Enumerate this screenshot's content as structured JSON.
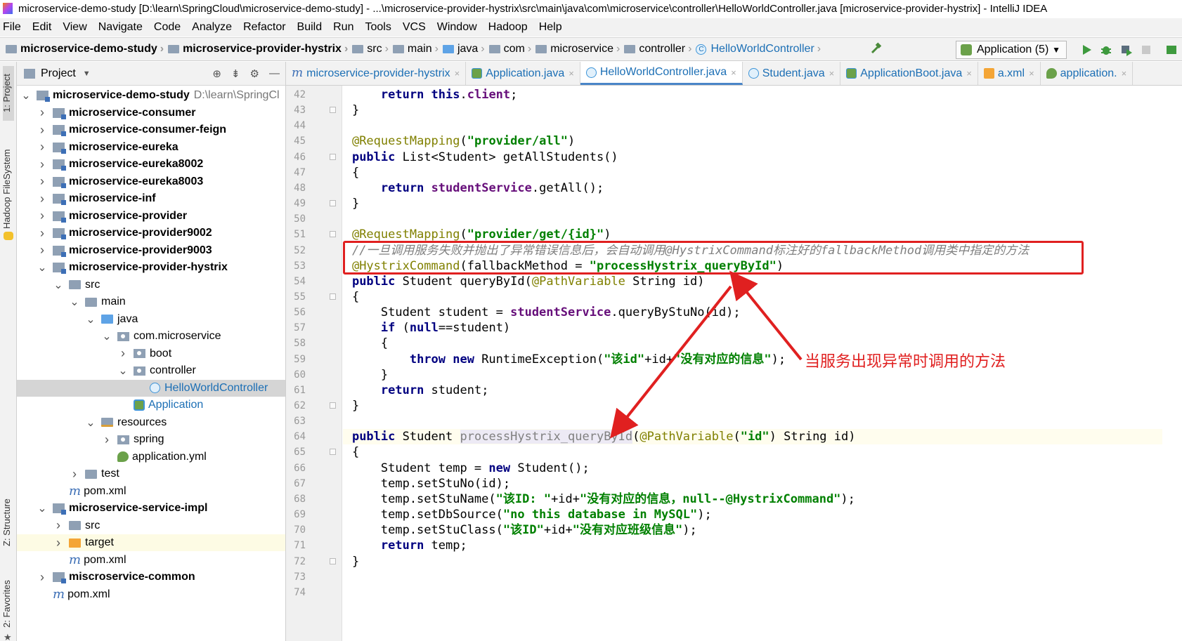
{
  "window": {
    "title": "microservice-demo-study [D:\\learn\\SpringCloud\\microservice-demo-study] - ...\\microservice-provider-hystrix\\src\\main\\java\\com\\microservice\\controller\\HelloWorldController.java [microservice-provider-hystrix] - IntelliJ IDEA"
  },
  "menu": [
    "File",
    "Edit",
    "View",
    "Navigate",
    "Code",
    "Analyze",
    "Refactor",
    "Build",
    "Run",
    "Tools",
    "VCS",
    "Window",
    "Hadoop",
    "Help"
  ],
  "breadcrumbs": [
    "microservice-demo-study",
    "microservice-provider-hystrix",
    "src",
    "main",
    "java",
    "com",
    "microservice",
    "controller",
    "HelloWorldController"
  ],
  "run_config": {
    "label": "Application (5)"
  },
  "left_strip": {
    "project": "1: Project",
    "hadoop": "Hadoop FileSystem",
    "structure": "Z: Structure",
    "favorites": "2: Favorites"
  },
  "project_panel": {
    "title": "Project",
    "tree": [
      {
        "label": "microservice-demo-study",
        "path": "D:\\learn\\SpringCl",
        "indent": 0,
        "arrow": "down",
        "icon": "mod",
        "bold": true
      },
      {
        "label": "microservice-consumer",
        "indent": 1,
        "arrow": "right",
        "icon": "mod",
        "bold": true
      },
      {
        "label": "microservice-consumer-feign",
        "indent": 1,
        "arrow": "right",
        "icon": "mod",
        "bold": true
      },
      {
        "label": "microservice-eureka",
        "indent": 1,
        "arrow": "right",
        "icon": "mod",
        "bold": true
      },
      {
        "label": "microservice-eureka8002",
        "indent": 1,
        "arrow": "right",
        "icon": "mod",
        "bold": true
      },
      {
        "label": "microservice-eureka8003",
        "indent": 1,
        "arrow": "right",
        "icon": "mod",
        "bold": true
      },
      {
        "label": "microservice-inf",
        "indent": 1,
        "arrow": "right",
        "icon": "mod",
        "bold": true
      },
      {
        "label": "microservice-provider",
        "indent": 1,
        "arrow": "right",
        "icon": "mod",
        "bold": true
      },
      {
        "label": "microservice-provider9002",
        "indent": 1,
        "arrow": "right",
        "icon": "mod",
        "bold": true
      },
      {
        "label": "microservice-provider9003",
        "indent": 1,
        "arrow": "right",
        "icon": "mod",
        "bold": true
      },
      {
        "label": "microservice-provider-hystrix",
        "indent": 1,
        "arrow": "down",
        "icon": "mod",
        "bold": true
      },
      {
        "label": "src",
        "indent": 2,
        "arrow": "down",
        "icon": "folder"
      },
      {
        "label": "main",
        "indent": 3,
        "arrow": "down",
        "icon": "folder"
      },
      {
        "label": "java",
        "indent": 4,
        "arrow": "down",
        "icon": "src"
      },
      {
        "label": "com.microservice",
        "indent": 5,
        "arrow": "down",
        "icon": "pkg"
      },
      {
        "label": "boot",
        "indent": 6,
        "arrow": "right",
        "icon": "pkg"
      },
      {
        "label": "controller",
        "indent": 6,
        "arrow": "down",
        "icon": "pkg"
      },
      {
        "label": "HelloWorldController",
        "indent": 7,
        "arrow": "",
        "icon": "class",
        "selected": true,
        "blue": true
      },
      {
        "label": "Application",
        "indent": 6,
        "arrow": "",
        "icon": "app",
        "blue": true
      },
      {
        "label": "resources",
        "indent": 4,
        "arrow": "down",
        "icon": "res"
      },
      {
        "label": "spring",
        "indent": 5,
        "arrow": "right",
        "icon": "pkg"
      },
      {
        "label": "application.yml",
        "indent": 5,
        "arrow": "",
        "icon": "yml"
      },
      {
        "label": "test",
        "indent": 3,
        "arrow": "right",
        "icon": "folder"
      },
      {
        "label": "pom.xml",
        "indent": 2,
        "arrow": "",
        "icon": "m"
      },
      {
        "label": "microservice-service-impl",
        "indent": 1,
        "arrow": "down",
        "icon": "mod",
        "bold": true
      },
      {
        "label": "src",
        "indent": 2,
        "arrow": "right",
        "icon": "folder"
      },
      {
        "label": "target",
        "indent": 2,
        "arrow": "right",
        "icon": "orange",
        "highlight": true
      },
      {
        "label": "pom.xml",
        "indent": 2,
        "arrow": "",
        "icon": "m"
      },
      {
        "label": "miscroservice-common",
        "indent": 1,
        "arrow": "right",
        "icon": "mod",
        "bold": true
      },
      {
        "label": "pom.xml",
        "indent": 1,
        "arrow": "",
        "icon": "m"
      }
    ]
  },
  "tabs": [
    {
      "label": "microservice-provider-hystrix",
      "icon": "m"
    },
    {
      "label": "Application.java",
      "icon": "app"
    },
    {
      "label": "HelloWorldController.java",
      "icon": "class",
      "active": true
    },
    {
      "label": "Student.java",
      "icon": "class"
    },
    {
      "label": "ApplicationBoot.java",
      "icon": "app"
    },
    {
      "label": "a.xml",
      "icon": "xml"
    },
    {
      "label": "application.",
      "icon": "yml"
    }
  ],
  "code": {
    "current_line": 64,
    "lines": [
      {
        "n": 42,
        "html": "        <span class='kw'>return this</span>.<span class='fld'>client</span>;"
      },
      {
        "n": 43,
        "html": "    }"
      },
      {
        "n": 44,
        "html": ""
      },
      {
        "n": 45,
        "html": "    <span class='an'>@RequestMapping</span>(<span class='str'>\"provider/all\"</span>)"
      },
      {
        "n": 46,
        "html": "    <span class='kw'>public</span> List&lt;Student&gt; getAllStudents()"
      },
      {
        "n": 47,
        "html": "    {"
      },
      {
        "n": 48,
        "html": "        <span class='kw'>return</span> <span class='fld'>studentService</span>.getAll();"
      },
      {
        "n": 49,
        "html": "    }"
      },
      {
        "n": 50,
        "html": ""
      },
      {
        "n": 51,
        "html": "    <span class='an'>@RequestMapping</span>(<span class='str'>\"provider/get/{id}\"</span>)"
      },
      {
        "n": 52,
        "html": "    <span class='cm'>//一旦调用服务失败并抛出了异常错误信息后，会自动调用@HystrixCommand标注好的fallbackMethod调用类中指定的方法</span>"
      },
      {
        "n": 53,
        "html": "    <span class='an'>@HystrixCommand</span>(fallbackMethod = <span class='str'>\"processHystrix_queryById\"</span>)"
      },
      {
        "n": 54,
        "html": "    <span class='kw'>public</span> Student queryById(<span class='an'>@PathVariable</span> String id)"
      },
      {
        "n": 55,
        "html": "    {"
      },
      {
        "n": 56,
        "html": "        Student student = <span class='fld'>studentService</span>.queryByStuNo(id);"
      },
      {
        "n": 57,
        "html": "        <span class='kw'>if</span> (<span class='kw'>null</span>==student)"
      },
      {
        "n": 58,
        "html": "        {"
      },
      {
        "n": 59,
        "html": "            <span class='kw'>throw new</span> RuntimeException(<span class='str'>\"该id\"</span>+id+<span class='str'>\"没有对应的信息\"</span>);"
      },
      {
        "n": 60,
        "html": "        }"
      },
      {
        "n": 61,
        "html": "        <span class='kw'>return</span> student;"
      },
      {
        "n": 62,
        "html": "    }"
      },
      {
        "n": 63,
        "html": ""
      },
      {
        "n": 64,
        "html": "    <span class='kw'>public</span> Student <span class='hl'>processHystrix_queryById</span>(<span class='an'>@PathVariable</span>(<span class='str'>\"id\"</span>) String id)"
      },
      {
        "n": 65,
        "html": "    {"
      },
      {
        "n": 66,
        "html": "        Student temp = <span class='kw'>new</span> Student();"
      },
      {
        "n": 67,
        "html": "        temp.setStuNo(id);"
      },
      {
        "n": 68,
        "html": "        temp.setStuName(<span class='str'>\"该ID: \"</span>+id+<span class='str'>\"没有对应的信息，null--@HystrixCommand\"</span>);"
      },
      {
        "n": 69,
        "html": "        temp.setDbSource(<span class='str'>\"no this database in MySQL\"</span>);"
      },
      {
        "n": 70,
        "html": "        temp.setStuClass(<span class='str'>\"该ID\"</span>+id+<span class='str'>\"没有对应班级信息\"</span>);"
      },
      {
        "n": 71,
        "html": "        <span class='kw'>return</span> temp;"
      },
      {
        "n": 72,
        "html": "    }"
      },
      {
        "n": 73,
        "html": "}"
      },
      {
        "n": 74,
        "html": ""
      }
    ]
  },
  "annotation": {
    "callout": "当服务出现异常时调用的方法",
    "color": "#e02020"
  }
}
